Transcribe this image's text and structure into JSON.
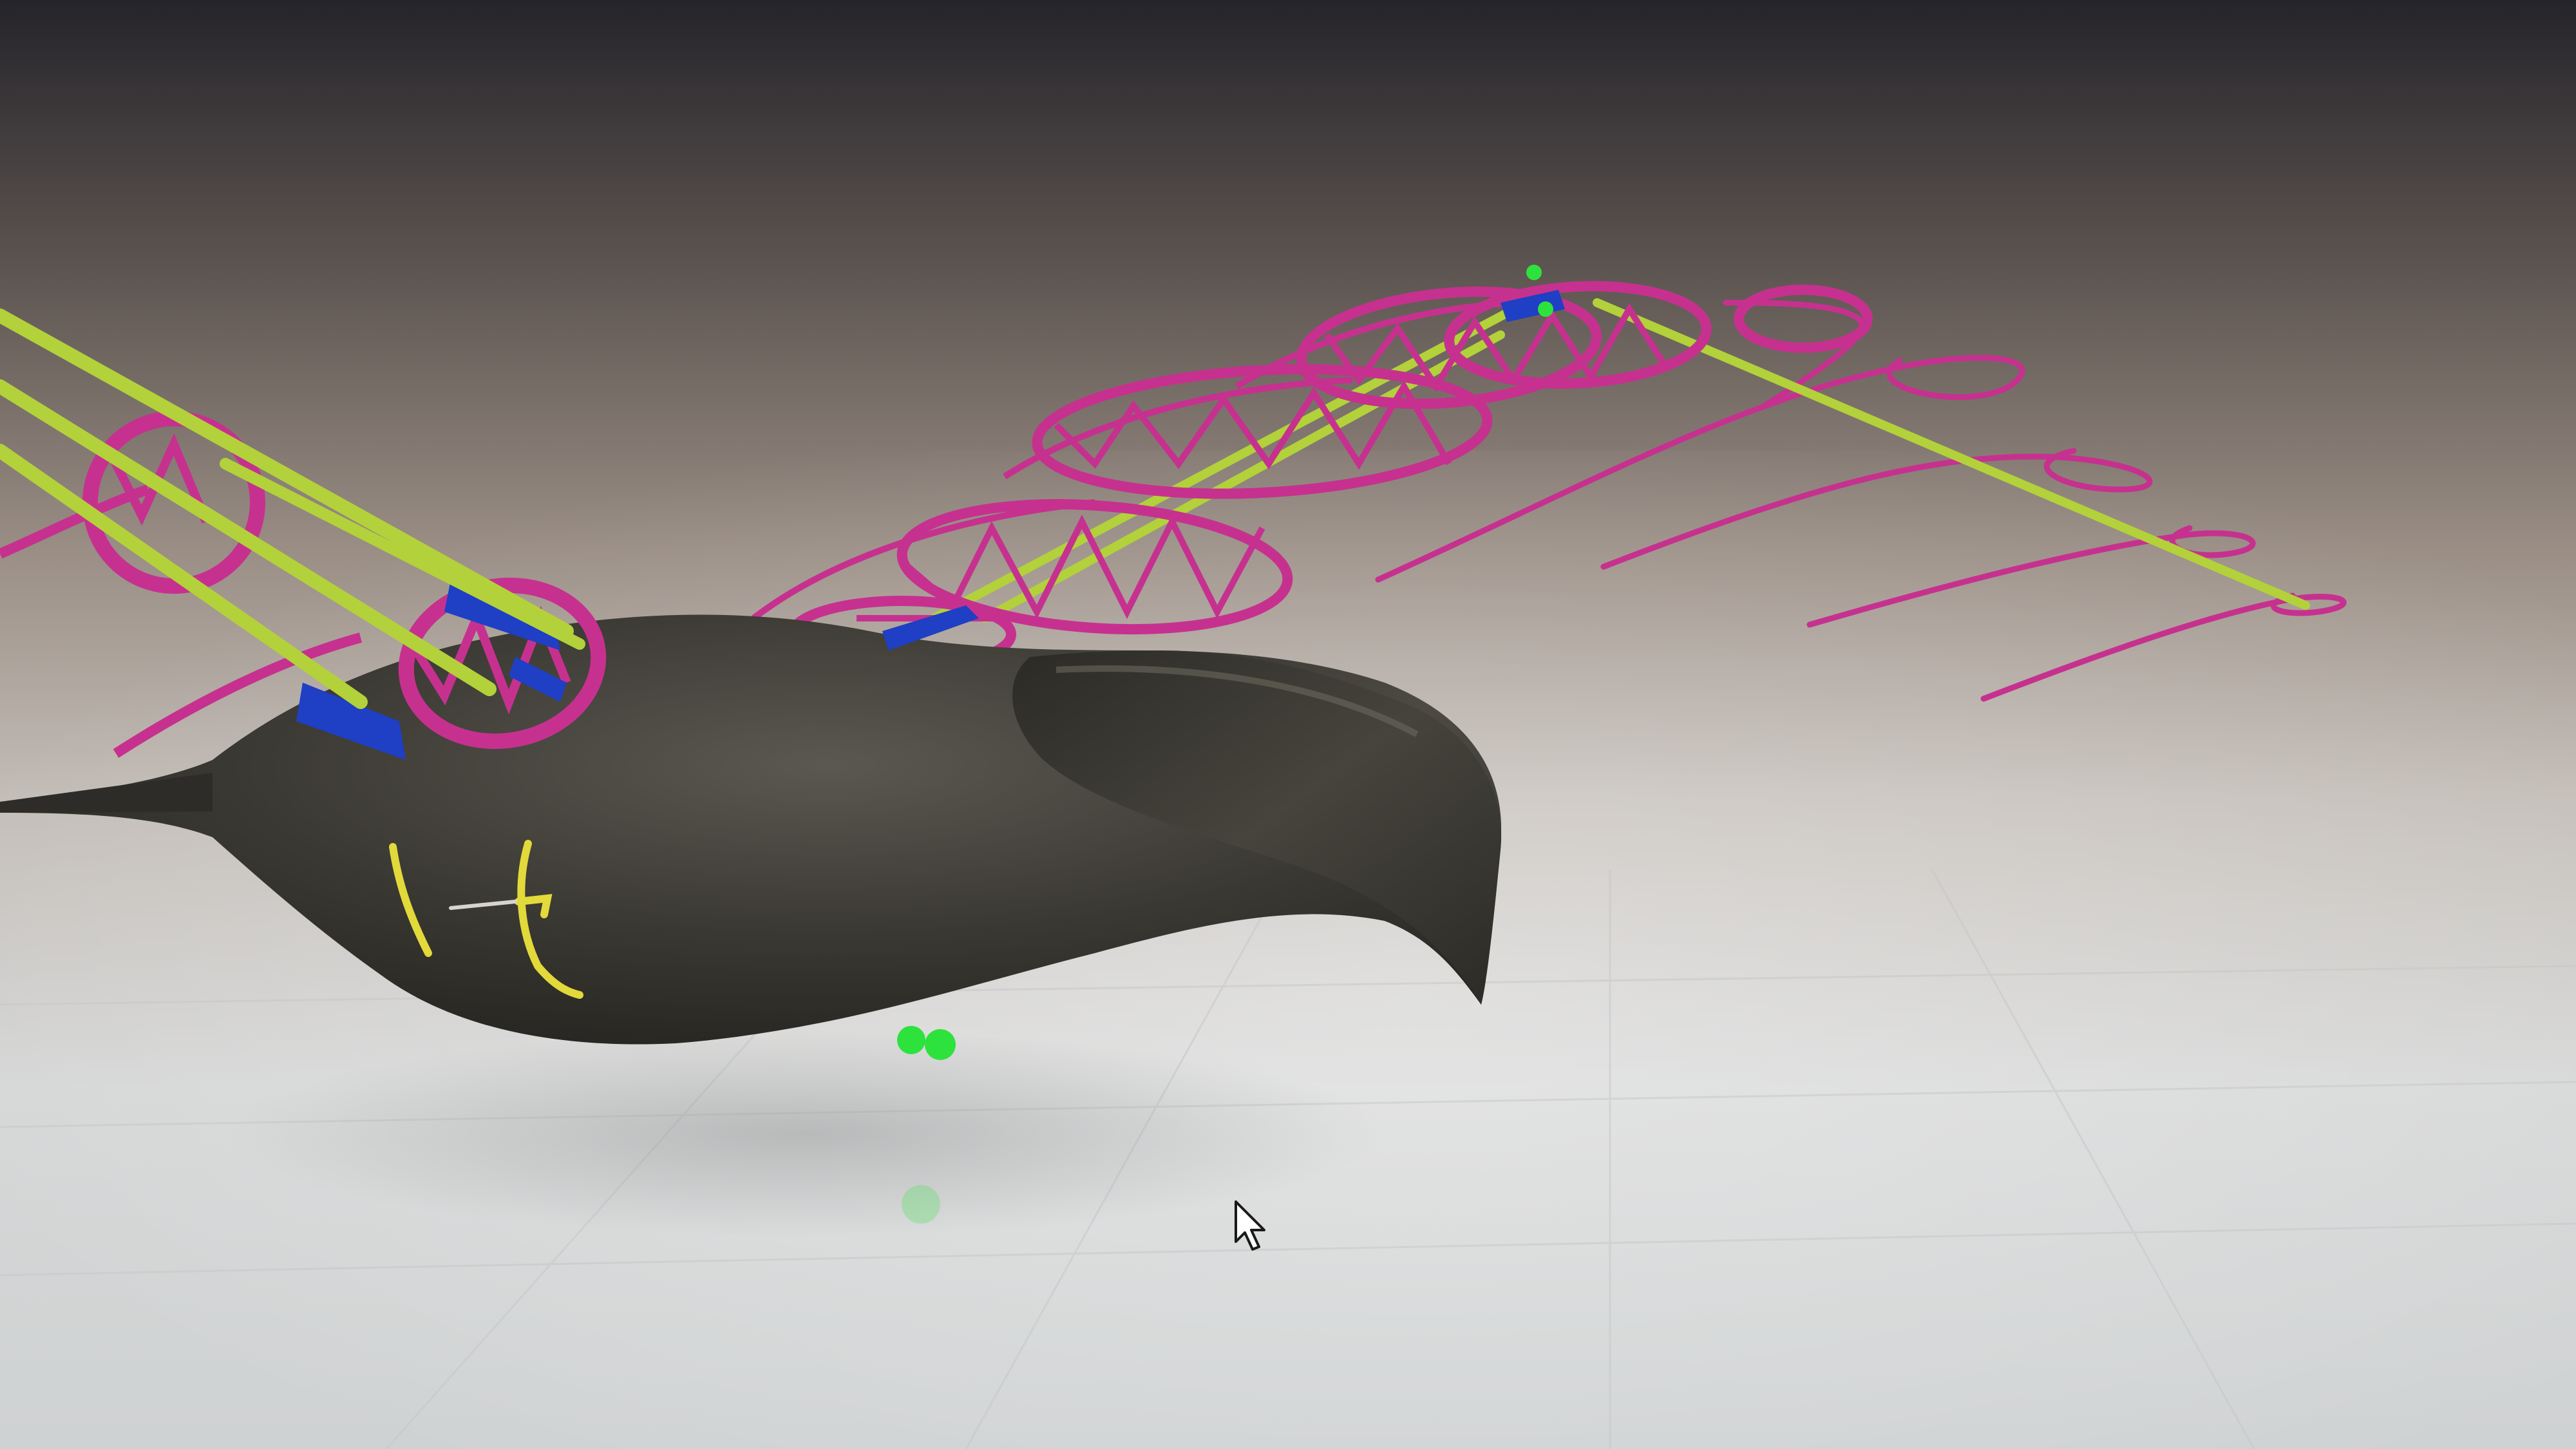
{
  "scene": {
    "background_top": "#2b2a2e",
    "background_mid": "#8f847c",
    "background_floor": "#d8d9d9",
    "fish_body_color": "#3a3832",
    "rib_color": "#c6318f",
    "rod_color": "#b3d13a",
    "bracket_color": "#1f3fc4",
    "marker_color": "#2ee23d",
    "fin_mark_color": "#e2d93a"
  },
  "objects": {
    "fish_body": "fish-body-mesh",
    "spine_rods": "spine-rods",
    "rib_hoops": "rib-hoops",
    "tail_ribs": "tail-rib-curves",
    "markers": "joint-markers",
    "cursor": "mouse-pointer-icon"
  }
}
